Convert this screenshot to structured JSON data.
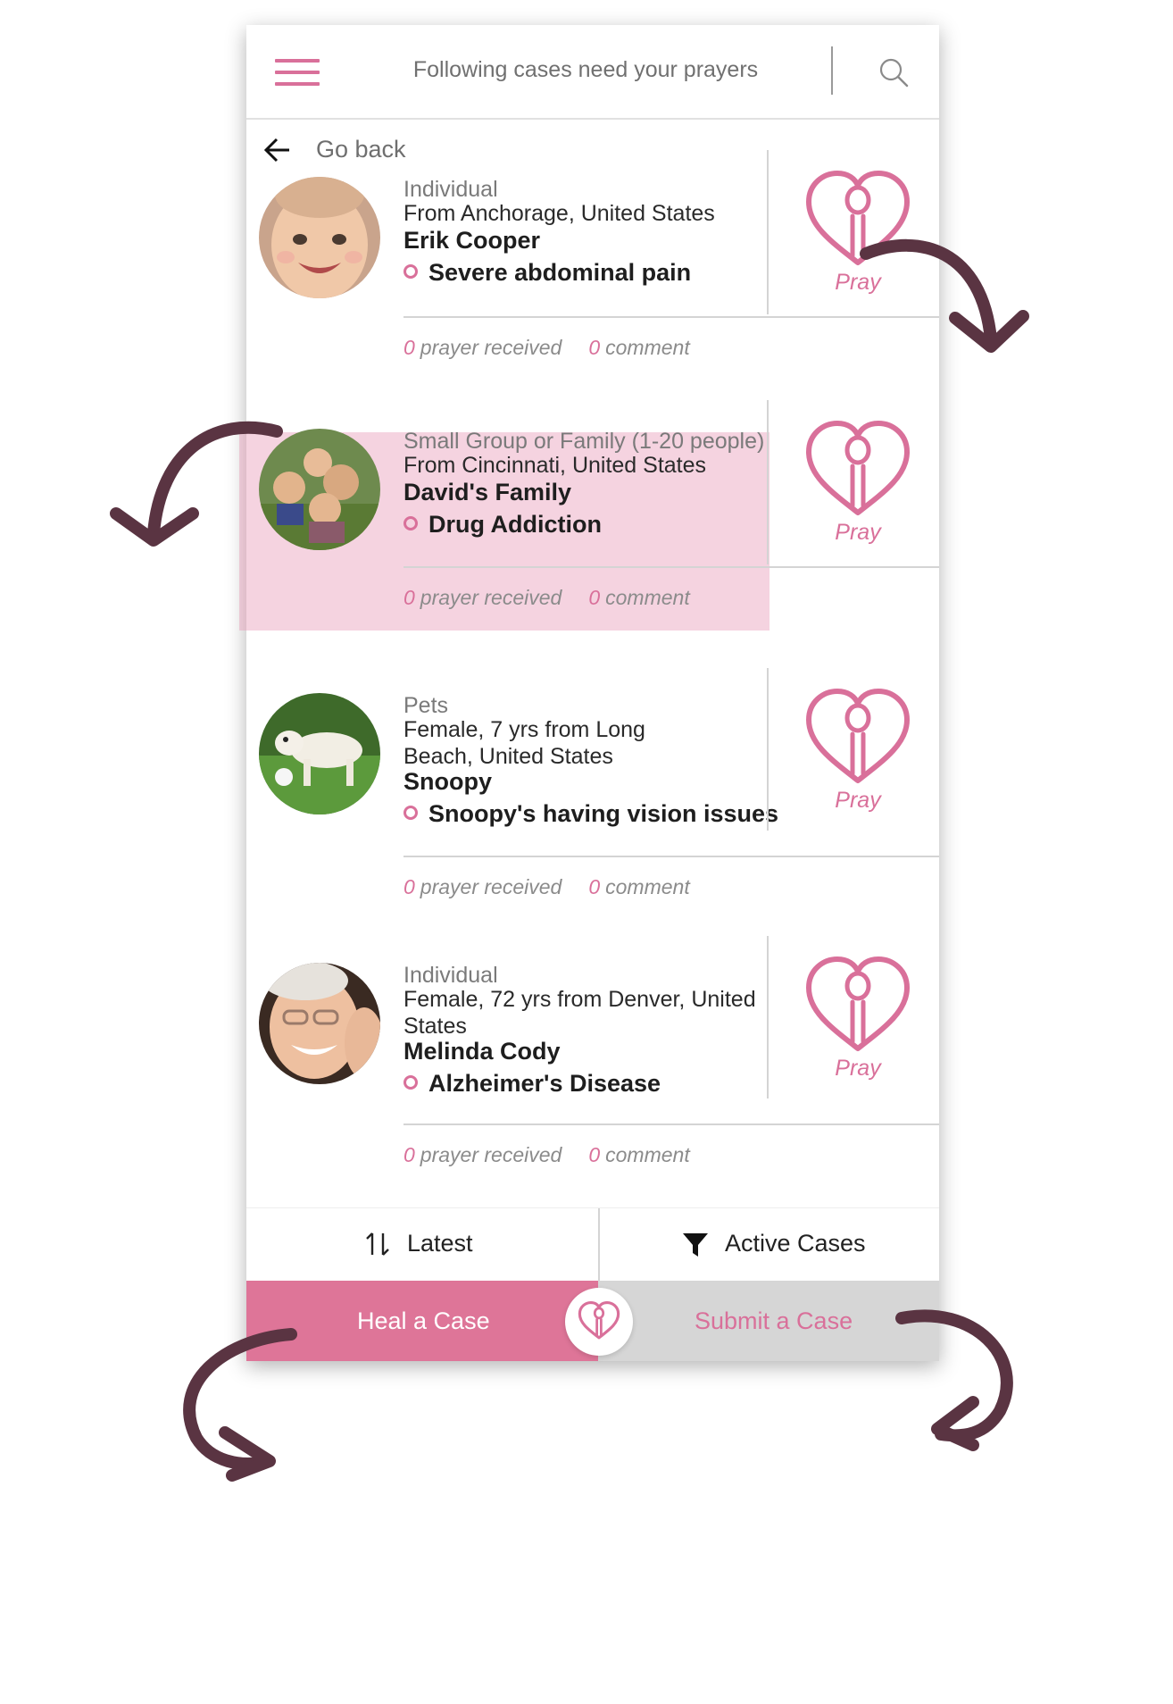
{
  "header": {
    "title": "Following cases need your prayers"
  },
  "nav": {
    "go_back": "Go back"
  },
  "cases": [
    {
      "category": "Individual",
      "location": "From Anchorage, United States",
      "name": "Erik Cooper",
      "condition": "Severe abdominal pain",
      "prayers_count": "0",
      "prayers_label": "prayer received",
      "comments_count": "0",
      "comments_label": "comment",
      "pray_label": "Pray",
      "highlighted": false
    },
    {
      "category": "Small Group or Family (1-20 people)",
      "location": "From Cincinnati, United States",
      "name": "David's Family",
      "condition": "Drug Addiction",
      "prayers_count": "0",
      "prayers_label": "prayer received",
      "comments_count": "0",
      "comments_label": "comment",
      "pray_label": "Pray",
      "highlighted": true
    },
    {
      "category": "Pets",
      "location": "Female, 7 yrs from Long Beach, United States",
      "name": "Snoopy",
      "condition": "Snoopy's having vision issues",
      "prayers_count": "0",
      "prayers_label": "prayer received",
      "comments_count": "0",
      "comments_label": "comment",
      "pray_label": "Pray",
      "highlighted": false
    },
    {
      "category": "Individual",
      "location": "Female, 72 yrs from Denver, United States",
      "name": "Melinda Cody",
      "condition": "Alzheimer's Disease",
      "prayers_count": "0",
      "prayers_label": "prayer received",
      "comments_count": "0",
      "comments_label": "comment",
      "pray_label": "Pray",
      "highlighted": false
    }
  ],
  "sort": {
    "label": "Latest",
    "icon": "sort-arrows-icon"
  },
  "filter": {
    "label": "Active Cases",
    "icon": "funnel-icon"
  },
  "tabs": {
    "heal": "Heal a Case",
    "submit": "Submit a Case",
    "center_icon": "heart-hands-icon"
  },
  "colors": {
    "accent": "#de7598",
    "accent_text": "#d9709a",
    "highlight": "#f3d2df",
    "inactive_tab": "#d6d6d6",
    "annotation_arrow": "#5a3442"
  }
}
